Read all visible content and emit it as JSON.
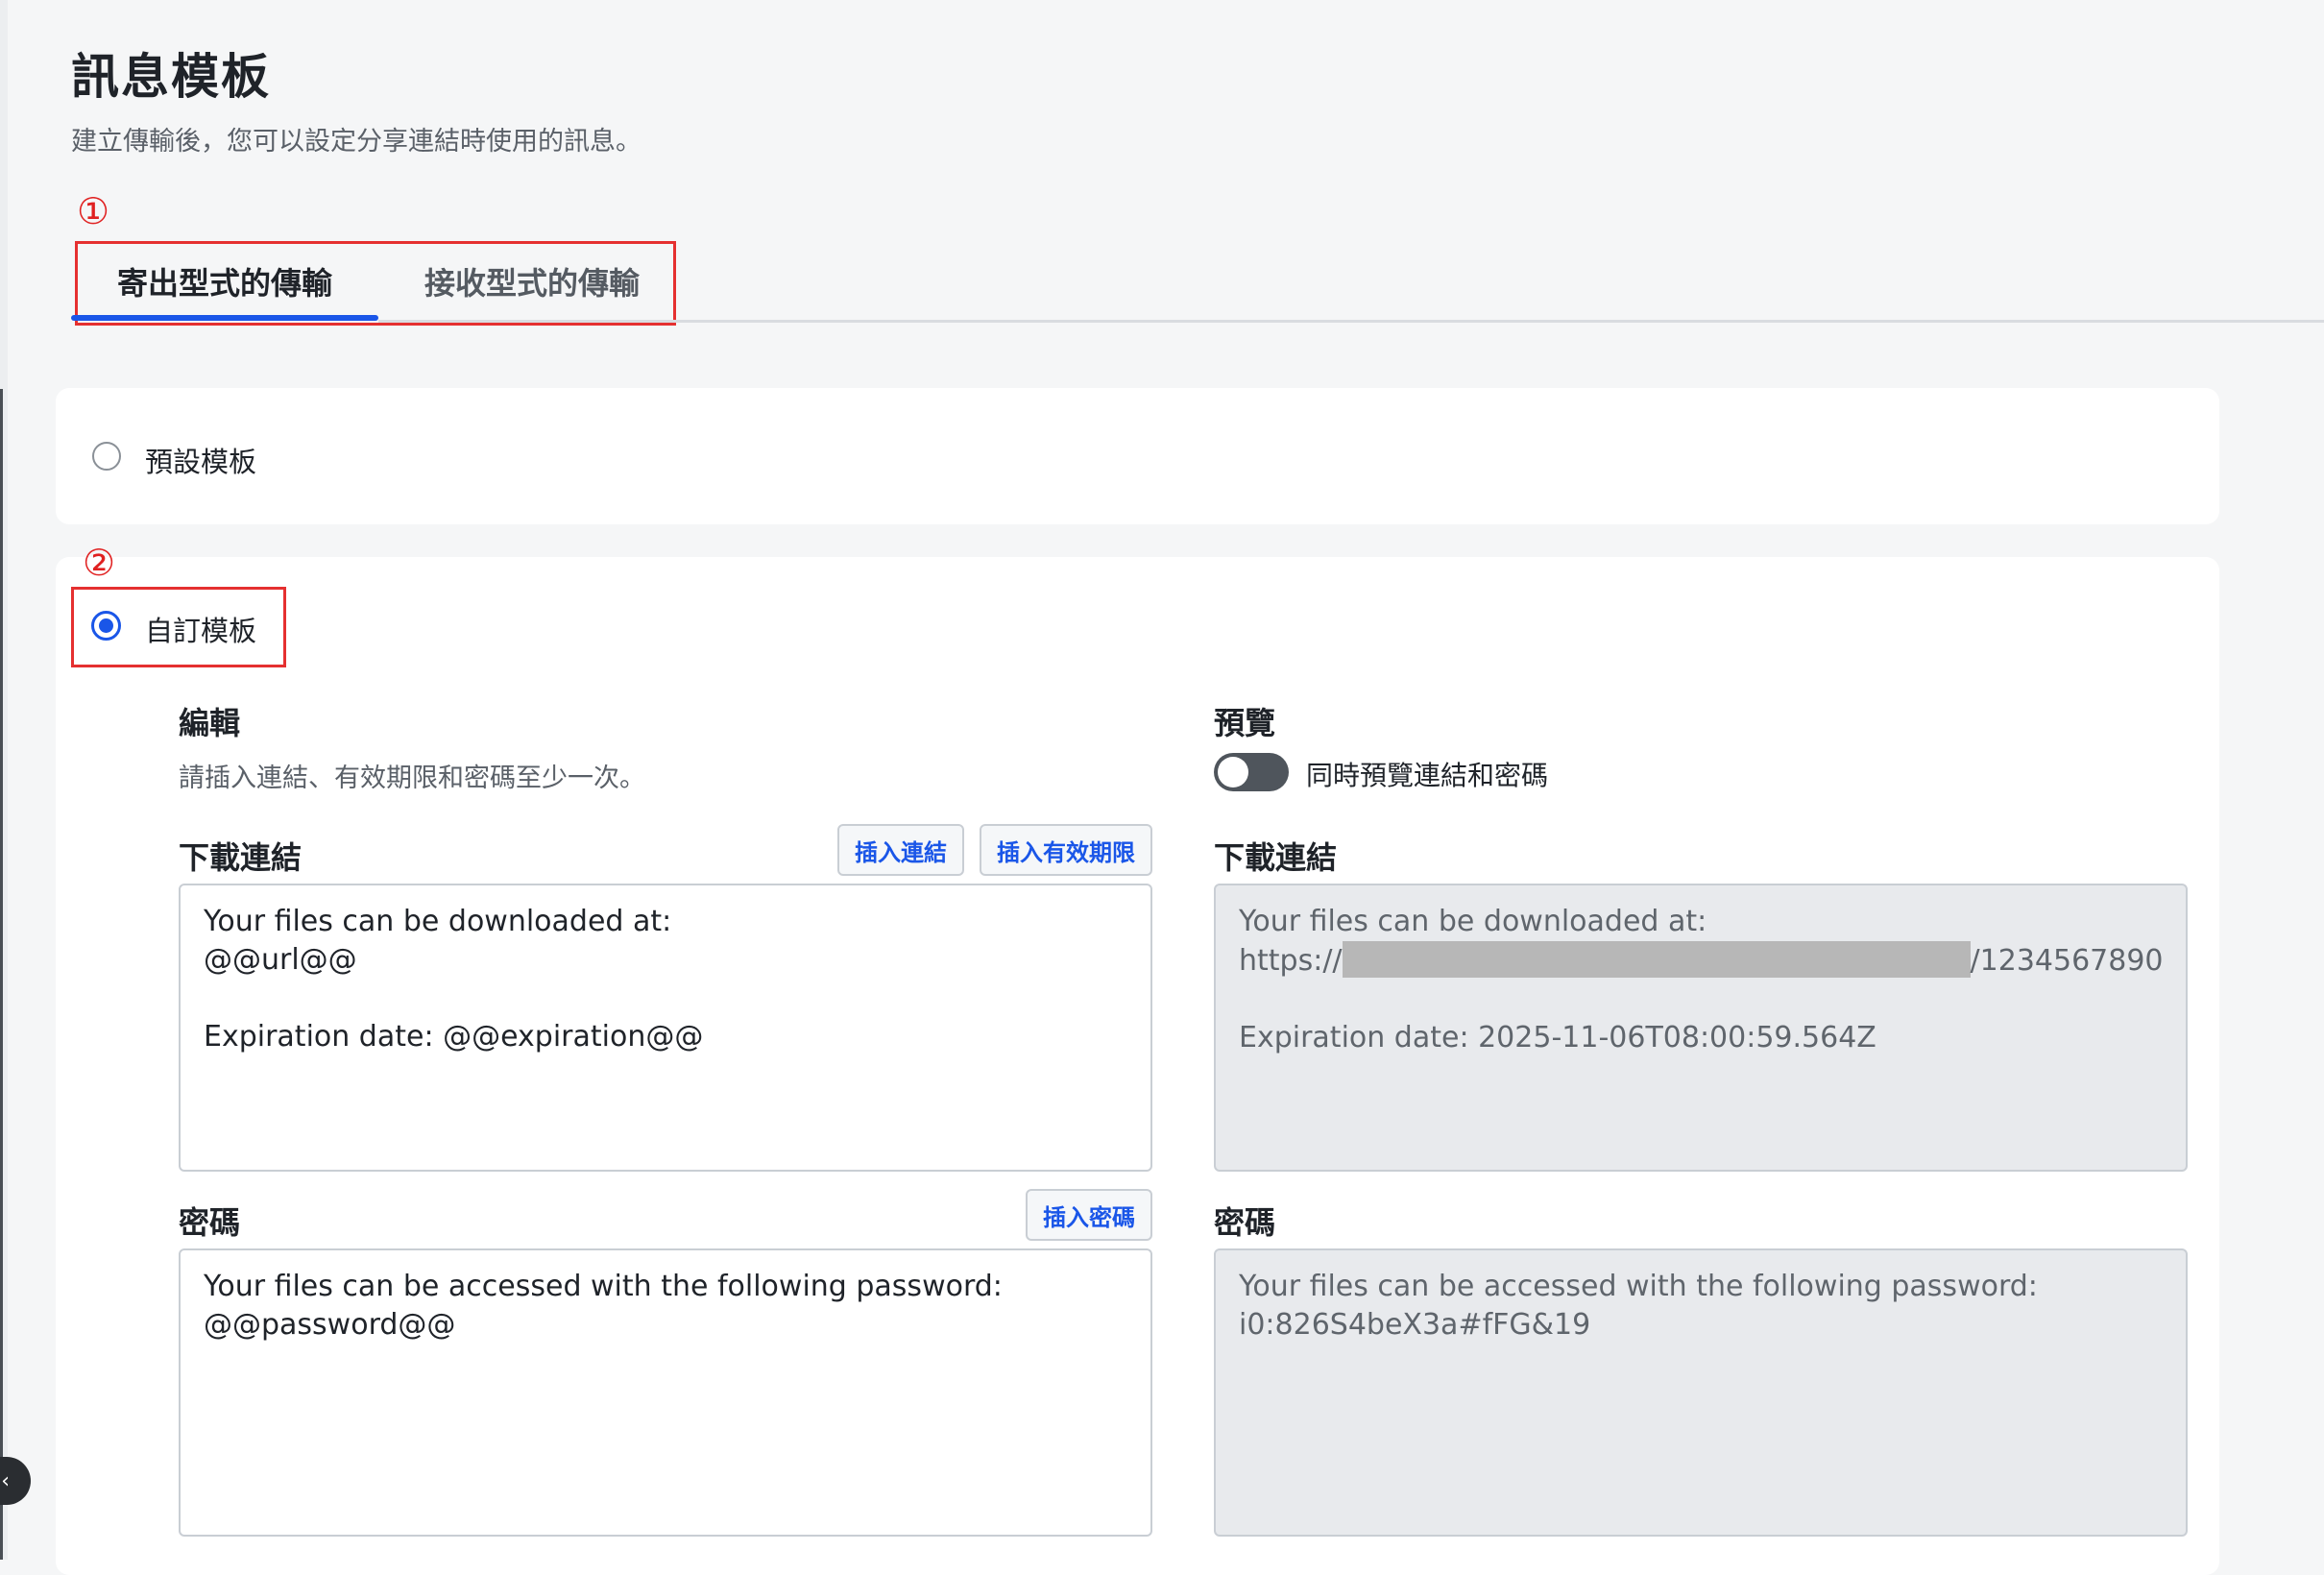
{
  "header": {
    "title": "訊息模板",
    "subtitle": "建立傳輸後，您可以設定分享連結時使用的訊息。"
  },
  "markers": {
    "tabs": "①",
    "custom": "②"
  },
  "tabs": [
    {
      "label": "寄出型式的傳輸",
      "active": true
    },
    {
      "label": "接收型式的傳輸",
      "active": false
    }
  ],
  "templates": {
    "default_label": "預設模板",
    "custom_label": "自訂模板",
    "selected": "custom"
  },
  "editor": {
    "heading": "編輯",
    "hint": "請插入連結、有效期限和密碼至少一次。",
    "download_heading": "下載連結",
    "insert_link_label": "插入連結",
    "insert_expiry_label": "插入有效期限",
    "download_text": "Your files can be downloaded at:\n@@url@@\n\nExpiration date: @@expiration@@",
    "password_heading": "密碼",
    "insert_password_label": "插入密碼",
    "password_text": "Your files can be accessed with the following password:\n@@password@@"
  },
  "preview": {
    "heading": "預覽",
    "toggle_label": "同時預覽連結和密碼",
    "toggle_on": false,
    "download_heading": "下載連結",
    "download_line1": "Your files can be downloaded at:",
    "url_prefix": "https://",
    "url_suffix": "/1234567890",
    "expiration_line": "Expiration date: 2025-11-06T08:00:59.564Z",
    "password_heading": "密碼",
    "password_text": "Your files can be accessed with the following password:\ni0:826S4beX3a#fFG&19"
  },
  "colors": {
    "accent": "#1a56e8",
    "annotation": "#e53030"
  },
  "icons": {
    "collapse": "chevron-left-icon"
  }
}
